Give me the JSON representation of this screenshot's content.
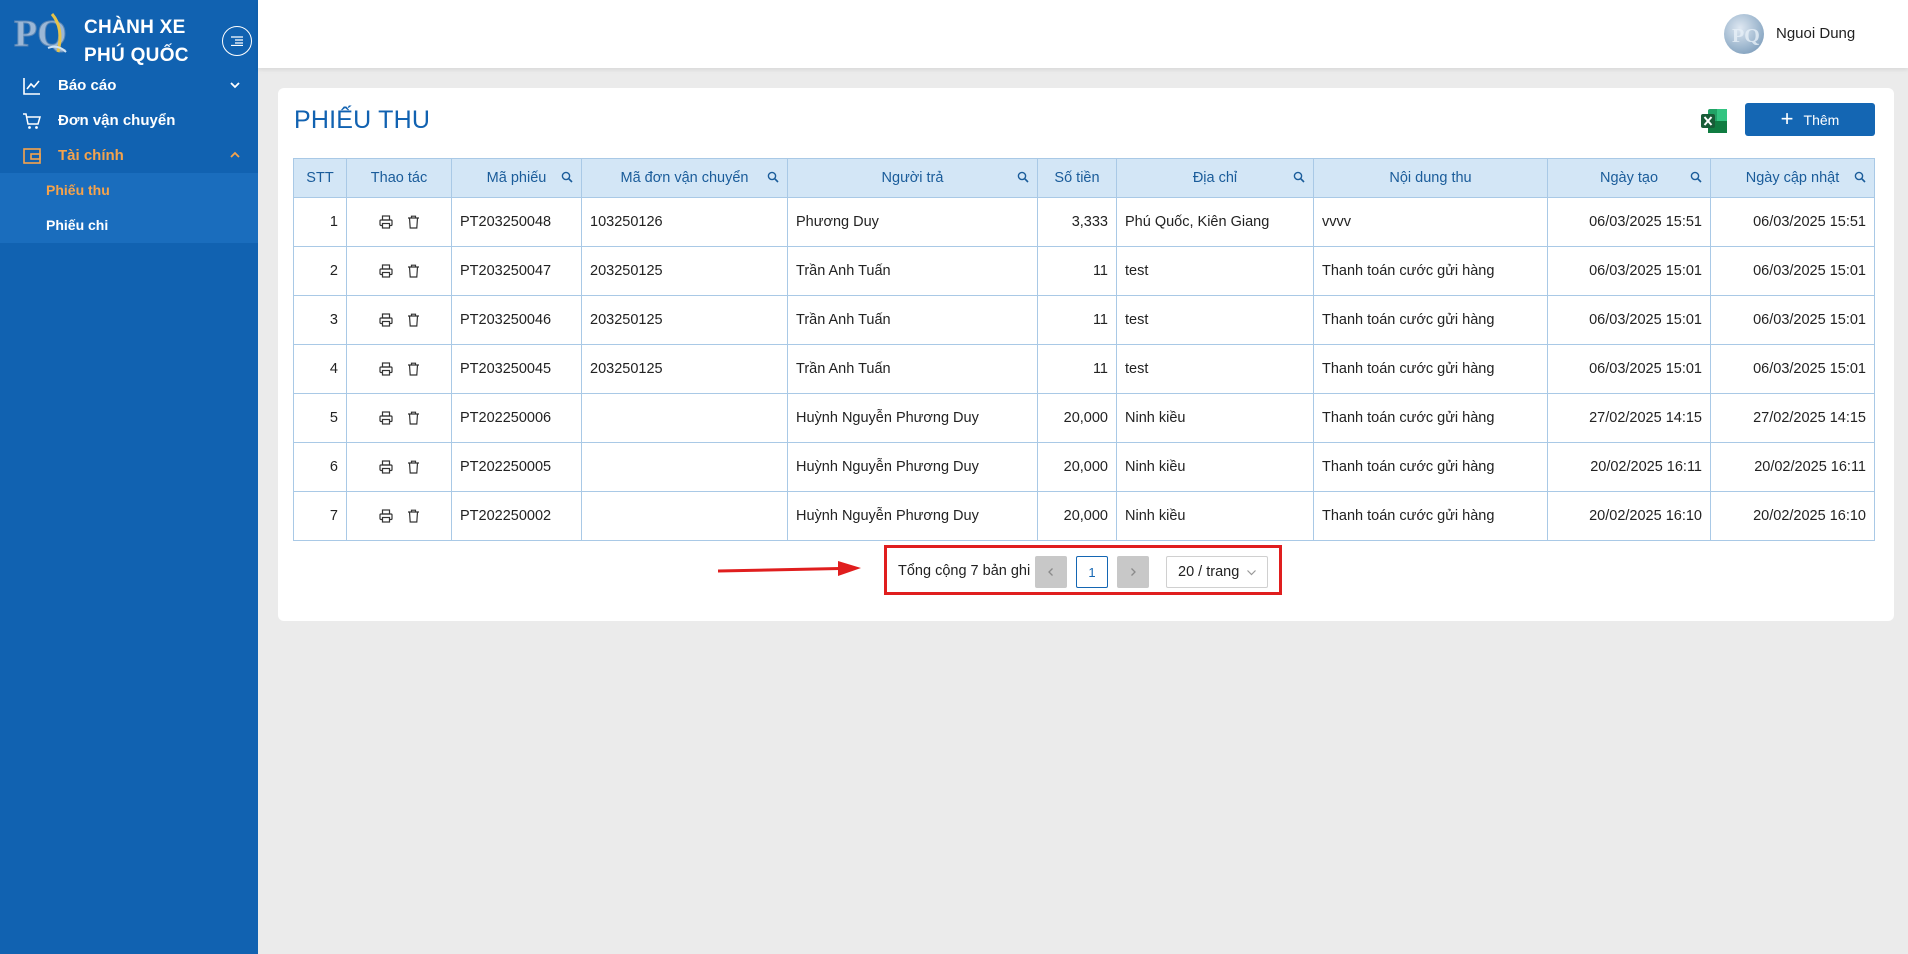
{
  "sidebar": {
    "brand": "CHÀNH XE PHÚ QUỐC",
    "logo_text": "PQ",
    "items": [
      {
        "label": "Báo cáo",
        "icon": "line-chart-icon"
      },
      {
        "label": "Đơn vận chuyển",
        "icon": "cart-icon"
      },
      {
        "label": "Tài chính",
        "icon": "wallet-icon"
      }
    ],
    "subitems": [
      {
        "label": "Phiếu thu"
      },
      {
        "label": "Phiếu chi"
      }
    ]
  },
  "header": {
    "user_name": "Nguoi Dung"
  },
  "page": {
    "title": "PHIẾU THU",
    "add_label": "Thêm"
  },
  "table": {
    "columns": [
      "STT",
      "Thao tác",
      "Mã phiếu",
      "Mã đơn vận chuyển",
      "Người trả",
      "Số tiền",
      "Địa chỉ",
      "Nội dung thu",
      "Ngày tạo",
      "Ngày cập nhật"
    ],
    "rows": [
      {
        "stt": "1",
        "code": "PT203250048",
        "order": "103250126",
        "payer": "Phương Duy",
        "amount": "3,333",
        "address": "Phú Quốc, Kiên Giang",
        "content": "vvvv",
        "created": "06/03/2025 15:51",
        "updated": "06/03/2025 15:51"
      },
      {
        "stt": "2",
        "code": "PT203250047",
        "order": "203250125",
        "payer": "Trần Anh Tuấn",
        "amount": "11",
        "address": "test",
        "content": "Thanh toán cước gửi hàng",
        "created": "06/03/2025 15:01",
        "updated": "06/03/2025 15:01"
      },
      {
        "stt": "3",
        "code": "PT203250046",
        "order": "203250125",
        "payer": "Trần Anh Tuấn",
        "amount": "11",
        "address": "test",
        "content": "Thanh toán cước gửi hàng",
        "created": "06/03/2025 15:01",
        "updated": "06/03/2025 15:01"
      },
      {
        "stt": "4",
        "code": "PT203250045",
        "order": "203250125",
        "payer": "Trần Anh Tuấn",
        "amount": "11",
        "address": "test",
        "content": "Thanh toán cước gửi hàng",
        "created": "06/03/2025 15:01",
        "updated": "06/03/2025 15:01"
      },
      {
        "stt": "5",
        "code": "PT202250006",
        "order": "",
        "payer": "Huỳnh Nguyễn Phương Duy",
        "amount": "20,000",
        "address": "Ninh kiều",
        "content": "Thanh toán cước gửi hàng",
        "created": "27/02/2025 14:15",
        "updated": "27/02/2025 14:15"
      },
      {
        "stt": "6",
        "code": "PT202250005",
        "order": "",
        "payer": "Huỳnh Nguyễn Phương Duy",
        "amount": "20,000",
        "address": "Ninh kiều",
        "content": "Thanh toán cước gửi hàng",
        "created": "20/02/2025 16:11",
        "updated": "20/02/2025 16:11"
      },
      {
        "stt": "7",
        "code": "PT202250002",
        "order": "",
        "payer": "Huỳnh Nguyễn Phương Duy",
        "amount": "20,000",
        "address": "Ninh kiều",
        "content": "Thanh toán cước gửi hàng",
        "created": "20/02/2025 16:10",
        "updated": "20/02/2025 16:10"
      }
    ]
  },
  "pagination": {
    "total_text": "Tổng cộng 7 bản ghi",
    "current_page": "1",
    "page_size": "20 / trang"
  },
  "colors": {
    "sidebar": "#1162b1",
    "accent": "#f6a34b",
    "primary": "#1466b3",
    "header_cell": "#d3e6f6",
    "highlight": "#e01e1e"
  }
}
